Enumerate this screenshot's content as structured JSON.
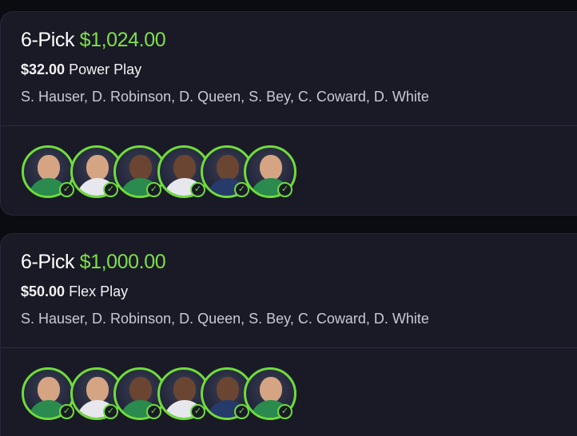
{
  "entries": [
    {
      "pick_count": "6-Pick",
      "payout": "$1,024.00",
      "stake": "$32.00",
      "play_type": "Power Play",
      "players": "S. Hauser, D. Robinson, D. Queen, S. Bey, C. Coward, D. White",
      "avatar_status_icon": "check-circle-icon"
    },
    {
      "pick_count": "6-Pick",
      "payout": "$1,000.00",
      "stake": "$50.00",
      "play_type": "Flex Play",
      "players": "S. Hauser, D. Robinson, D. Queen, S. Bey, C. Coward, D. White",
      "avatar_status_icon": "check-circle-icon"
    }
  ],
  "colors": {
    "background": "#0b0b12",
    "card": "#1a1a26",
    "accent_green": "#7ee04a",
    "text_primary": "#ffffff",
    "text_secondary": "#c9c9d4"
  }
}
